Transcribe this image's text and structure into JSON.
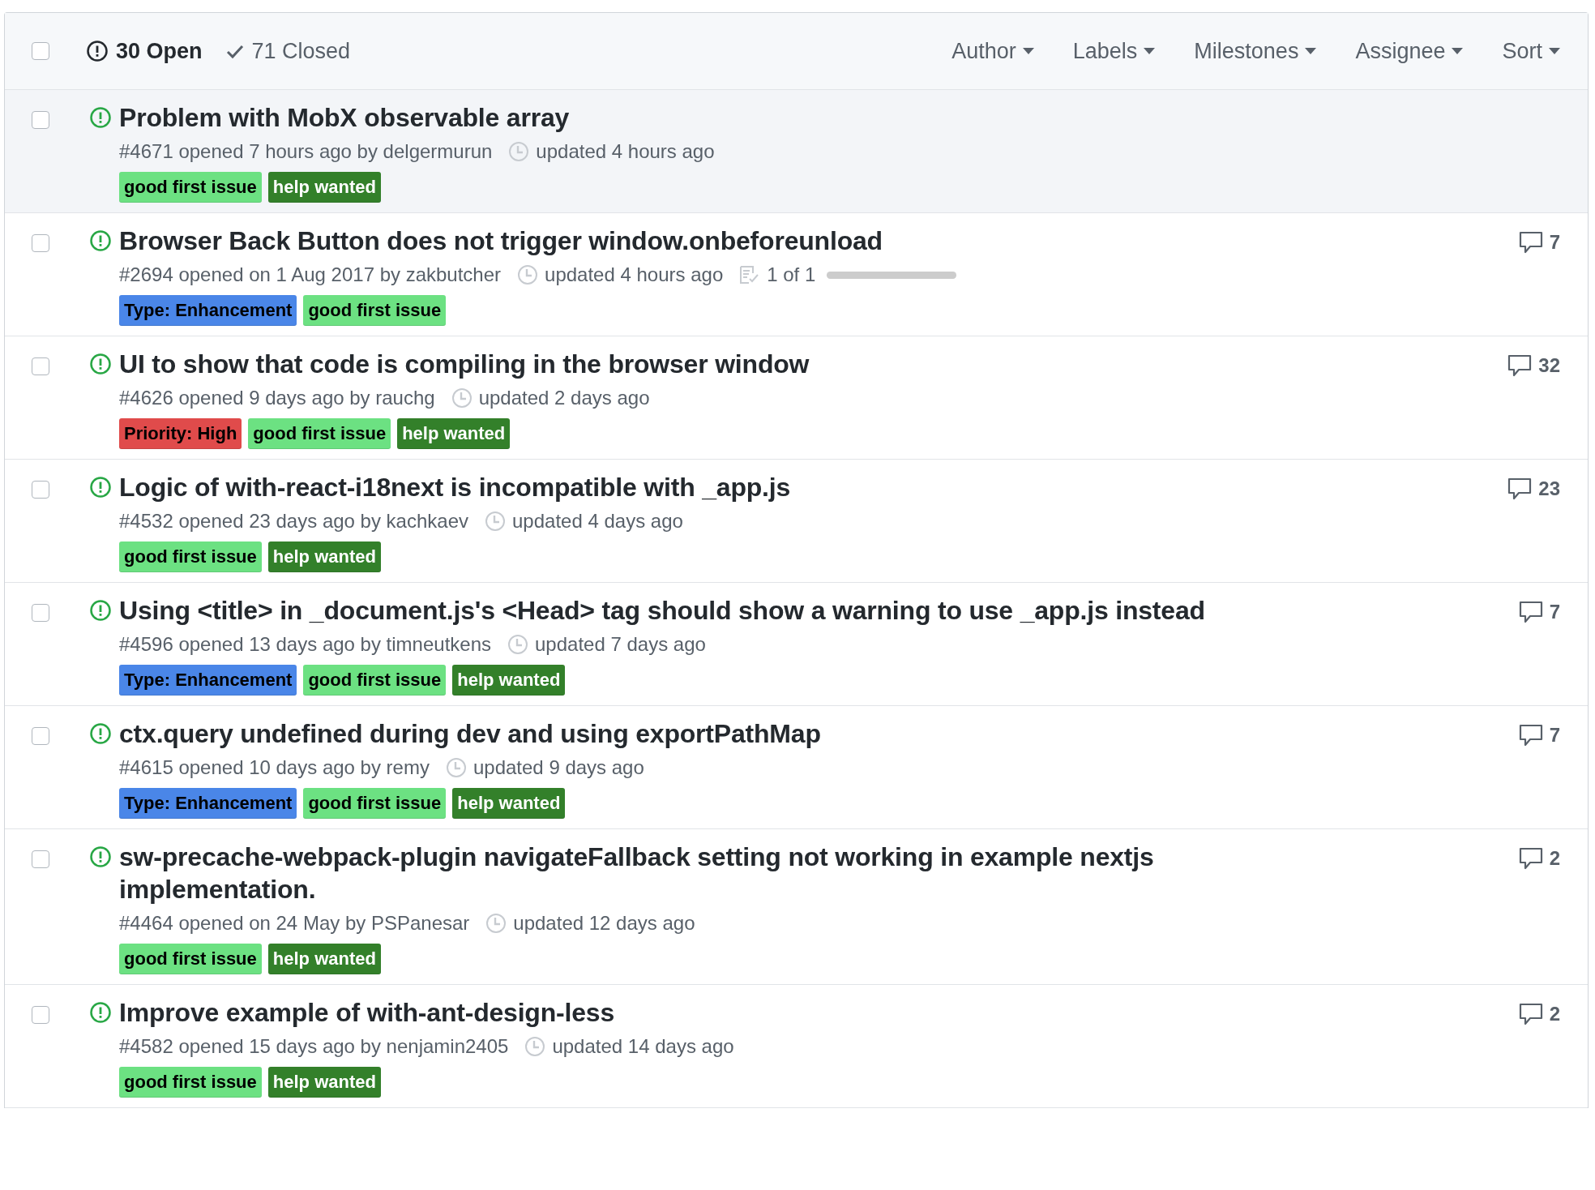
{
  "header": {
    "select_all_checked": false,
    "open_count": "30 Open",
    "closed_count": "71 Closed",
    "filters": [
      "Author",
      "Labels",
      "Milestones",
      "Assignee",
      "Sort"
    ]
  },
  "issues": [
    {
      "selected": true,
      "checked": false,
      "title": "Problem with MobX observable array",
      "meta": "#4671 opened 7 hours ago by delgermurun",
      "updated": "updated 4 hours ago",
      "labels": [
        {
          "name": "good first issue",
          "color": "#6ce182"
        },
        {
          "name": "help wanted",
          "color": "#33802a"
        }
      ]
    },
    {
      "selected": false,
      "checked": false,
      "title": "Browser Back Button does not trigger window.onbeforeunload",
      "meta": "#2694 opened on 1 Aug 2017 by zakbutcher",
      "updated": "updated 4 hours ago",
      "tasks": {
        "text": "1 of 1",
        "level": 1
      },
      "comments": "7",
      "labels": [
        {
          "name": "Type: Enhancement",
          "color": "#4a86e8"
        },
        {
          "name": "good first issue",
          "color": "#6ce182"
        }
      ]
    },
    {
      "selected": false,
      "checked": false,
      "title": "UI to show that code is compiling in the browser window",
      "meta": "#4626 opened 9 days ago by rauchg",
      "updated": "updated 2 days ago",
      "comments": "32",
      "labels": [
        {
          "name": "Priority: High",
          "color": "#e04b4b"
        },
        {
          "name": "good first issue",
          "color": "#6ce182"
        },
        {
          "name": "help wanted",
          "color": "#33802a"
        }
      ]
    },
    {
      "selected": false,
      "checked": false,
      "title": "Logic of with-react-i18next is incompatible with _app.js",
      "meta": "#4532 opened 23 days ago by kachkaev",
      "updated": "updated 4 days ago",
      "comments": "23",
      "labels": [
        {
          "name": "good first issue",
          "color": "#6ce182"
        },
        {
          "name": "help wanted",
          "color": "#33802a"
        }
      ]
    },
    {
      "selected": false,
      "checked": false,
      "title": "Using <title> in _document.js's <Head> tag should show a warning to use _app.js instead",
      "meta": "#4596 opened 13 days ago by timneutkens",
      "updated": "updated 7 days ago",
      "comments": "7",
      "labels": [
        {
          "name": "Type: Enhancement",
          "color": "#4a86e8"
        },
        {
          "name": "good first issue",
          "color": "#6ce182"
        },
        {
          "name": "help wanted",
          "color": "#33802a"
        }
      ]
    },
    {
      "selected": false,
      "checked": false,
      "title": "ctx.query undefined during dev and using exportPathMap",
      "meta": "#4615 opened 10 days ago by remy",
      "updated": "updated 9 days ago",
      "comments": "7",
      "labels": [
        {
          "name": "Type: Enhancement",
          "color": "#4a86e8"
        },
        {
          "name": "good first issue",
          "color": "#6ce182"
        },
        {
          "name": "help wanted",
          "color": "#33802a"
        }
      ]
    },
    {
      "selected": false,
      "checked": false,
      "title": "sw-precache-webpack-plugin navigateFallback setting not working in example nextjs implementation.",
      "meta": "#4464 opened on 24 May by PSPanesar",
      "updated": "updated 12 days ago",
      "comments": "2",
      "labels": [
        {
          "name": "good first issue",
          "color": "#6ce182"
        },
        {
          "name": "help wanted",
          "color": "#33802a"
        }
      ]
    },
    {
      "selected": false,
      "checked": false,
      "title": "Improve example of with-ant-design-less",
      "meta": "#4582 opened 15 days ago by nenjamin2405",
      "updated": "updated 14 days ago",
      "comments": "2",
      "labels": [
        {
          "name": "good first issue",
          "color": "#6ce182"
        },
        {
          "name": "help wanted",
          "color": "#33802a"
        }
      ]
    }
  ]
}
